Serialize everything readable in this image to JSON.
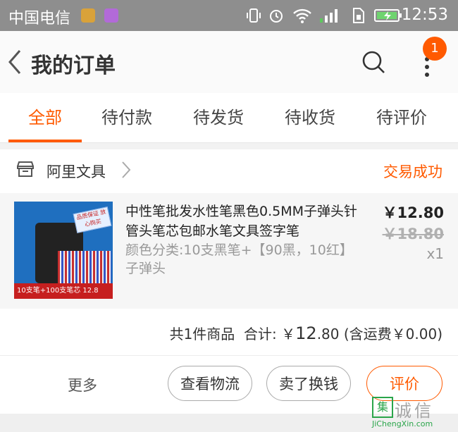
{
  "status_bar": {
    "carrier": "中国电信",
    "time": "12:53",
    "icons": [
      "vibrate-icon",
      "alarm-icon",
      "wifi-icon",
      "signal-icon",
      "sim-icon",
      "battery-charging-icon"
    ]
  },
  "header": {
    "title": "我的订单",
    "notification_count": "1"
  },
  "tabs": [
    {
      "label": "全部",
      "active": true
    },
    {
      "label": "待付款"
    },
    {
      "label": "待发货"
    },
    {
      "label": "待收货"
    },
    {
      "label": "待评价"
    }
  ],
  "order": {
    "shop_name": "阿里文具",
    "status": "交易成功",
    "product": {
      "name": "中性笔批发水性笔黑色0.5MM子弹头针管头笔芯包邮水笔文具签字笔",
      "spec": "颜色分类:10支黑笔+【90黑，10红】子弹头",
      "price": "￥12.80",
      "original_price": "￥18.80",
      "quantity": "x1",
      "thumb_tag": "品质保证 放心购买",
      "thumb_banner": "10支笔+100支笔芯 12.8"
    },
    "summary": {
      "count_text": "共1件商品",
      "total_label": "合计: ",
      "total_currency": "￥",
      "total_int": "12",
      "total_dec": ".80",
      "shipping": "(含运费￥0.00)"
    },
    "actions": {
      "more": "更多",
      "logistics": "查看物流",
      "resell": "卖了换钱",
      "review": "评价"
    }
  },
  "watermark": {
    "mark": "集",
    "name": "诚信",
    "url": "JiChengXin.com"
  },
  "colors": {
    "accent": "#ff5a00",
    "status_bar": "#8e8e8e"
  }
}
